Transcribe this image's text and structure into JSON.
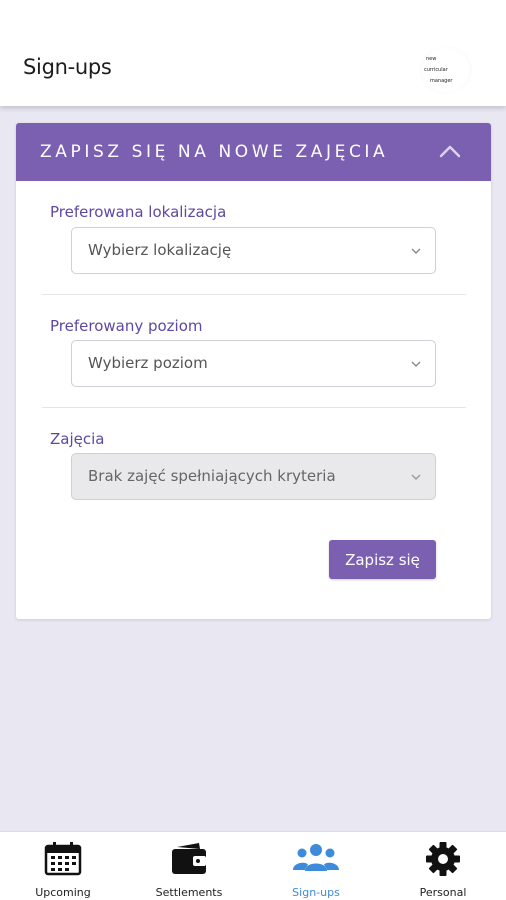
{
  "header": {
    "title": "Sign-ups",
    "logo_lines": [
      "new",
      "curricular",
      "manager"
    ]
  },
  "signup_card": {
    "title": "ZAPISZ SIĘ NA NOWE ZAJĘCIA",
    "collapse_icon": "chevron-up-icon",
    "fields": [
      {
        "label": "Preferowana lokalizacja",
        "value": "Wybierz lokalizację",
        "disabled": false
      },
      {
        "label": "Preferowany poziom",
        "value": "Wybierz poziom",
        "disabled": false
      },
      {
        "label": "Zajęcia",
        "value": "Brak zajęć spełniających kryteria",
        "disabled": true
      }
    ],
    "submit_label": "Zapisz się"
  },
  "bottom_nav": {
    "items": [
      {
        "label": "Upcoming",
        "icon": "calendar-icon",
        "active": false
      },
      {
        "label": "Settlements",
        "icon": "wallet-icon",
        "active": false
      },
      {
        "label": "Sign-ups",
        "icon": "users-icon",
        "active": true
      },
      {
        "label": "Personal",
        "icon": "gear-icon",
        "active": false
      }
    ]
  },
  "colors": {
    "accent": "#7b5fb0",
    "label": "#5e48a2",
    "active_nav": "#3d8bd9",
    "background": "#e9e7f2"
  }
}
